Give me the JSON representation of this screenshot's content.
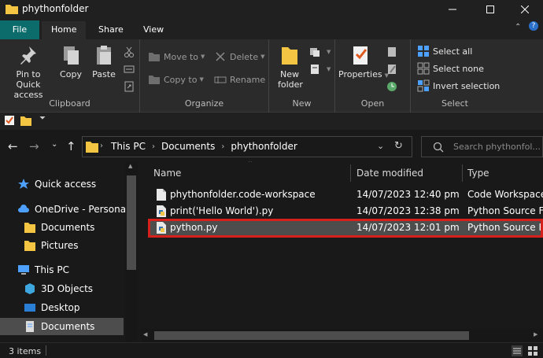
{
  "window": {
    "title": "phythonfolder",
    "minimize_icon": "minimize-icon",
    "maximize_icon": "maximize-icon",
    "close_icon": "close-icon"
  },
  "tabs": [
    {
      "label": "File"
    },
    {
      "label": "Home"
    },
    {
      "label": "Share"
    },
    {
      "label": "View"
    }
  ],
  "ribbon": {
    "clipboard": {
      "label": "Clipboard",
      "pin": "Pin to Quick access",
      "copy": "Copy",
      "paste": "Paste"
    },
    "organize": {
      "label": "Organize",
      "move_to": "Move to",
      "copy_to": "Copy to",
      "delete": "Delete",
      "rename": "Rename"
    },
    "new": {
      "label": "New",
      "new_folder": "New folder"
    },
    "open": {
      "label": "Open",
      "properties": "Properties"
    },
    "select": {
      "label": "Select",
      "select_all": "Select all",
      "select_none": "Select none",
      "invert_selection": "Invert selection"
    }
  },
  "address": {
    "crumbs": [
      "This PC",
      "Documents",
      "phythonfolder"
    ],
    "search_placeholder": "Search phythonfol..."
  },
  "nav": {
    "items": [
      {
        "label": "Quick access"
      },
      {
        "label": "OneDrive - Personal"
      },
      {
        "label": "Documents"
      },
      {
        "label": "Pictures"
      },
      {
        "label": "This PC"
      },
      {
        "label": "3D Objects"
      },
      {
        "label": "Desktop"
      },
      {
        "label": "Documents"
      }
    ]
  },
  "columns": {
    "name": "Name",
    "date": "Date modified",
    "type": "Type"
  },
  "files": [
    {
      "name": "phythonfolder.code-workspace",
      "date": "14/07/2023 12:40 pm",
      "type": "Code Workspace ..."
    },
    {
      "name": "print('Hello World').py",
      "date": "14/07/2023 12:38 pm",
      "type": "Python Source File"
    },
    {
      "name": "python.py",
      "date": "14/07/2023 12:01 pm",
      "type": "Python Source File"
    }
  ],
  "status": {
    "count": "3 items"
  },
  "colors": {
    "file_tab": "#0c6b6b",
    "highlight": "#d6201c",
    "folder": "#f4c542"
  }
}
